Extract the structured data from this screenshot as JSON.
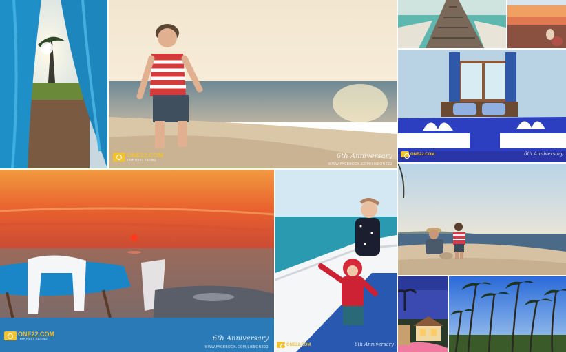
{
  "collage": {
    "brand": "ONE22.COM",
    "tagline": "TRIP REST EATING",
    "signature": "6th Anniversary",
    "facebook": "WWW.FACEBOOK.COM/LIKEONE22"
  },
  "photos": [
    {
      "id": "curtain-porch",
      "subject": "blue curtains framing sunlit porch with palm trees"
    },
    {
      "id": "boy-on-beach",
      "subject": "boy in striped shirt walking on beach at sunset"
    },
    {
      "id": "wooden-pier",
      "subject": "wooden pier over turquoise water"
    },
    {
      "id": "sunset-shore",
      "subject": "people on beach at orange sunset"
    },
    {
      "id": "hotel-bedroom",
      "subject": "blue bedroom with towel swans on bed"
    },
    {
      "id": "sunset-dinner",
      "subject": "sun setting over sea behind dining table and chairs"
    },
    {
      "id": "kids-on-boat",
      "subject": "children on a boat deck at sea"
    },
    {
      "id": "sandcastle",
      "subject": "man and child building sandcastle on beach"
    },
    {
      "id": "night-resort",
      "subject": "resort bungalow at dusk"
    },
    {
      "id": "palm-grove",
      "subject": "coconut palm grove under blue sky"
    }
  ]
}
